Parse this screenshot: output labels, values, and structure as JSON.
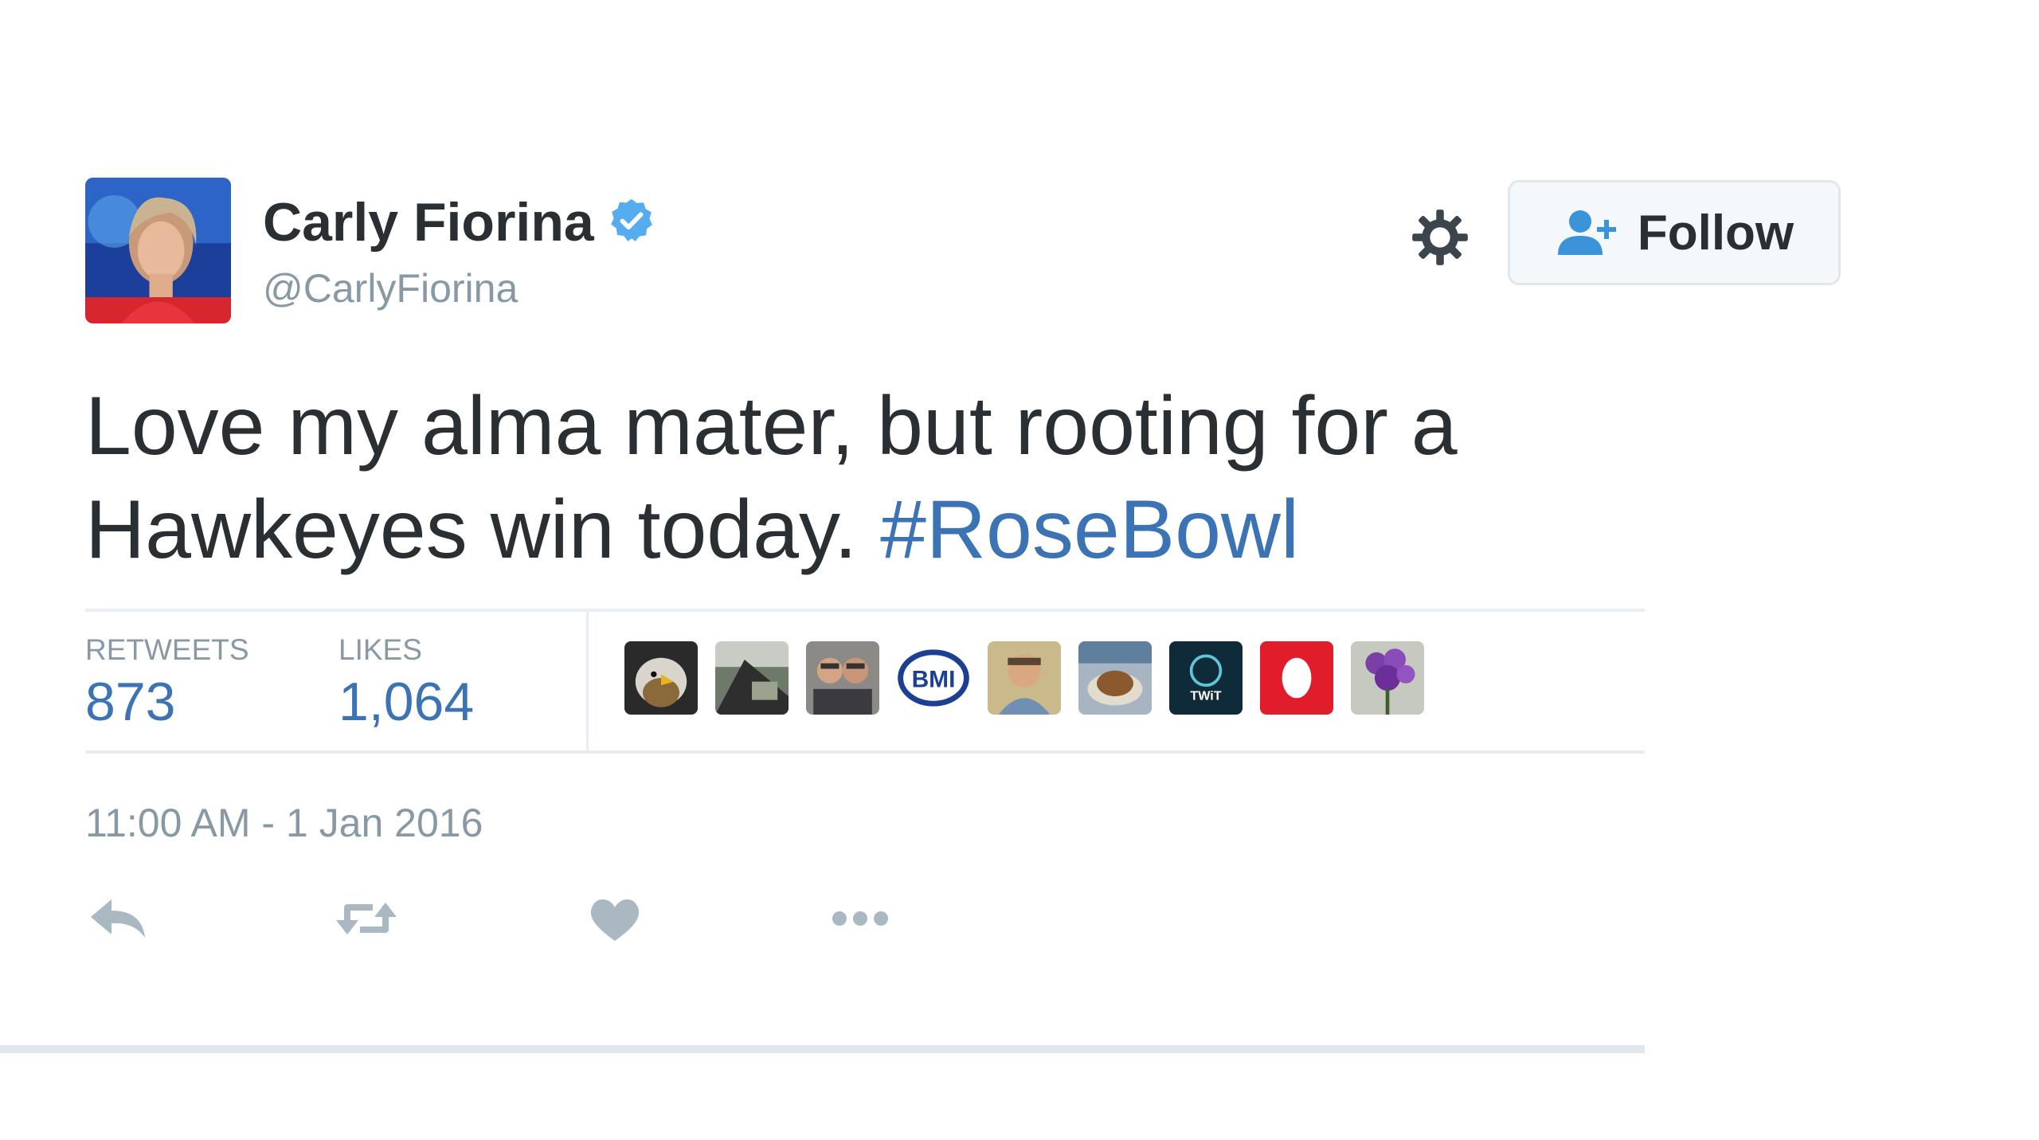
{
  "user": {
    "display_name": "Carly Fiorina",
    "handle": "@CarlyFiorina",
    "verified": true
  },
  "header": {
    "follow_label": "Follow",
    "gear_icon": "gear-icon",
    "follow_icon": "user-add-icon"
  },
  "tweet": {
    "text_line1": "Love my alma mater, but rooting for a",
    "text_line2": "Hawkeyes win today.",
    "hashtag": "#RoseBowl"
  },
  "stats": {
    "retweets_label": "RETWEETS",
    "retweets_value": "873",
    "likes_label": "LIKES",
    "likes_value": "1,064"
  },
  "likers": [
    {
      "name": "liker-eagle-avatar"
    },
    {
      "name": "liker-photo-avatar"
    },
    {
      "name": "liker-couple-avatar"
    },
    {
      "name": "liker-bmi-avatar",
      "text": "BMI"
    },
    {
      "name": "liker-man-avatar"
    },
    {
      "name": "liker-food-avatar"
    },
    {
      "name": "liker-twit-avatar",
      "text": "TWiT"
    },
    {
      "name": "liker-red-logo-avatar"
    },
    {
      "name": "liker-purple-flowers-avatar"
    }
  ],
  "timestamp": "11:00 AM - 1 Jan 2016",
  "actions": [
    "reply-icon",
    "retweet-icon",
    "like-icon",
    "more-icon"
  ],
  "colors": {
    "text": "#292f33",
    "secondary": "#8899a6",
    "link": "#3b73b5",
    "verified": "#55acee",
    "border": "#e1e8ed"
  }
}
